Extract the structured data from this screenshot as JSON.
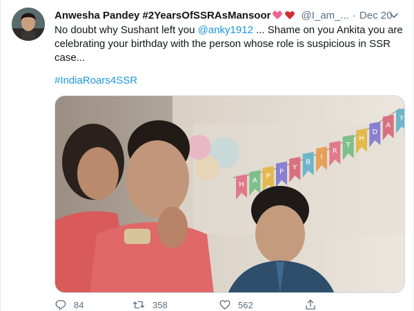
{
  "tweet": {
    "display_name": "Anwesha Pandey #2YearsOfSSRAsMansoor",
    "handle": "@I_am_...",
    "separator": "·",
    "date": "Dec 20",
    "text_part1": "No doubt why Sushant left you ",
    "mention": "@anky1912",
    "text_part2": " ... Shame on you Ankita you are celebrating your birthday with the person whose role is suspicious in SSR case...",
    "hashtag": "#IndiaRoars4SSR",
    "banner_letters": [
      "H",
      "A",
      "P",
      "P",
      "Y",
      "B",
      "I",
      "R",
      "T",
      "H",
      "D",
      "A",
      "Y"
    ],
    "stats": {
      "replies": "84",
      "retweets": "358",
      "likes": "562"
    }
  },
  "colors": {
    "link": "#1b95e0",
    "secondary_text": "#5b7083",
    "heart": "#e0245e"
  },
  "icons": [
    "reply-icon",
    "retweet-icon",
    "like-icon",
    "share-icon",
    "chevron-down-icon",
    "heart-emoji-icon"
  ]
}
